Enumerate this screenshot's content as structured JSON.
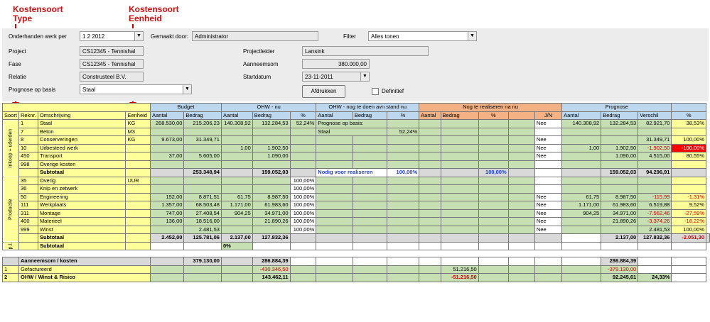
{
  "annotations": {
    "type_label": "Kostensoort\nType",
    "unit_label": "Kostensoort\nEenheid"
  },
  "form": {
    "onderhanden_label": "Onderhanden werk per",
    "onderhanden_value": "1 2 2012",
    "gemaakt_label": "Gemaakt door:",
    "gemaakt_value": "Administrator",
    "filter_label": "Filter",
    "filter_value": "Alles tonen",
    "project_label": "Project",
    "project_value": "CS12345 - Tennishal",
    "fase_label": "Fase",
    "fase_value": "CS12345 - Tennishal",
    "relatie_label": "Relatie",
    "relatie_value": "Construsteel B.V.",
    "prognose_label": "Prognose op basis",
    "prognose_value": "Staal",
    "projectleider_label": "Projectleider",
    "projectleider_value": "Lansink",
    "aanneemsom_label": "Aanneemsom",
    "aanneemsom_value": "380.000,00",
    "startdatum_label": "Startdatum",
    "startdatum_value": "23-11-2011",
    "print_button": "Afdrukken",
    "definitief_label": "Definitief"
  },
  "groups": {
    "budget": "Budget",
    "ohw_nu": "OHW - nu",
    "ohw_tedoen": "OHW - nog te doen avn stand nu",
    "nog_realiseren": "Nog te realiseren na nu",
    "prognose": "Prognose"
  },
  "columns": {
    "soort": "Soort",
    "reknr": "Reknr.",
    "omschrijving": "Omschrijving",
    "eenheid": "Eenheid",
    "aantal": "Aantal",
    "bedrag": "Bedrag",
    "pct": "%",
    "jn": "J/N",
    "verschil": "Verschil"
  },
  "section_labels": {
    "inkoop": "Inkoop + uderden",
    "productie": "Productie",
    "extra": "p.t."
  },
  "inkoop_rows": [
    {
      "reknr": "1",
      "oms": "Staal",
      "eh": "KG",
      "b_aantal": "268.530,00",
      "b_bedrag": "215.206,23",
      "o_aantal": "140.308,92",
      "o_bedrag": "132.284,53",
      "o_pct": "52,24%",
      "t_label": "Prognose op basis:",
      "jn": "Nee",
      "p_aantal": "140.308,92",
      "p_bedrag": "132.284,53",
      "p_verschil": "82.921,70",
      "p_pct": "38,53%"
    },
    {
      "reknr": "7",
      "oms": "Beton",
      "eh": "M3",
      "b_aantal": "",
      "b_bedrag": "",
      "o_aantal": "",
      "o_bedrag": "",
      "o_pct": "",
      "t_label": "Staal",
      "t_pct": "52,24%",
      "jn": "",
      "p_aantal": "",
      "p_bedrag": "",
      "p_verschil": "",
      "p_pct": ""
    },
    {
      "reknr": "8",
      "oms": "Conserveringen",
      "eh": "KG",
      "b_aantal": "9.673,00",
      "b_bedrag": "31.349,71",
      "o_aantal": "",
      "o_bedrag": "",
      "o_pct": "",
      "t_label": "",
      "jn": "Nee",
      "p_aantal": "",
      "p_bedrag": "",
      "p_verschil": "31.349,71",
      "p_pct": "100,00%"
    },
    {
      "reknr": "10",
      "oms": "Uitbesteed werk",
      "eh": "",
      "b_aantal": "",
      "b_bedrag": "",
      "o_aantal": "1,00",
      "o_bedrag": "1.902,50",
      "o_pct": "",
      "t_label": "",
      "jn": "Nee",
      "p_aantal": "1,00",
      "p_bedrag": "1.902,50",
      "p_verschil": "-1.902,50",
      "p_pct": "-100,00%"
    },
    {
      "reknr": "450",
      "oms": "Transport",
      "eh": "",
      "b_aantal": "37,00",
      "b_bedrag": "5.605,00",
      "o_aantal": "",
      "o_bedrag": "1.090,00",
      "o_pct": "",
      "t_label": "",
      "jn": "Nee",
      "p_aantal": "",
      "p_bedrag": "1.090,00",
      "p_verschil": "4.515,00",
      "p_pct": "80,55%"
    },
    {
      "reknr": "998",
      "oms": "Overige kosten",
      "eh": "",
      "b_aantal": "",
      "b_bedrag": "",
      "o_aantal": "",
      "o_bedrag": "",
      "o_pct": "",
      "t_label": "",
      "jn": "",
      "p_aantal": "",
      "p_bedrag": "",
      "p_verschil": "",
      "p_pct": ""
    }
  ],
  "inkoop_subtotal": {
    "label": "Subtotaal",
    "b_bedrag": "253.348,94",
    "o_bedrag": "159.052,03",
    "nodig": "Nodig voor realiseren",
    "nodig_pct": "100,00%",
    "n_pct": "100,00%",
    "p_bedrag": "159.052,03",
    "p_verschil": "94.296,91"
  },
  "productie_rows": [
    {
      "reknr": "35",
      "oms": "Overig",
      "eh": "UUR",
      "b_aantal": "",
      "b_bedrag": "",
      "o_aantal": "",
      "o_bedrag": "",
      "o_pct": "100,00%",
      "jn": "",
      "p_aantal": "",
      "p_bedrag": "",
      "p_verschil": "",
      "p_pct": ""
    },
    {
      "reknr": "36",
      "oms": "Knip en zetwerk",
      "eh": "",
      "b_aantal": "",
      "b_bedrag": "",
      "o_aantal": "",
      "o_bedrag": "",
      "o_pct": "100,00%",
      "jn": "",
      "p_aantal": "",
      "p_bedrag": "",
      "p_verschil": "",
      "p_pct": ""
    },
    {
      "reknr": "50",
      "oms": "Engineering",
      "eh": "",
      "b_aantal": "152,00",
      "b_bedrag": "8.871,51",
      "o_aantal": "61,75",
      "o_bedrag": "8.987,50",
      "o_pct": "100,00%",
      "jn": "Nee",
      "p_aantal": "61,75",
      "p_bedrag": "8.987,50",
      "p_verschil": "-115,99",
      "p_pct": "-1,31%"
    },
    {
      "reknr": "111",
      "oms": "Werkplaats",
      "eh": "",
      "b_aantal": "1.357,00",
      "b_bedrag": "68.503,48",
      "o_aantal": "1.171,00",
      "o_bedrag": "61.983,60",
      "o_pct": "100,00%",
      "jn": "Nee",
      "p_aantal": "1.171,00",
      "p_bedrag": "61.983,60",
      "p_verschil": "6.519,88",
      "p_pct": "9,52%"
    },
    {
      "reknr": "311",
      "oms": "Montage",
      "eh": "",
      "b_aantal": "747,00",
      "b_bedrag": "27.408,54",
      "o_aantal": "904,25",
      "o_bedrag": "34.971,00",
      "o_pct": "100,00%",
      "jn": "Nee",
      "p_aantal": "904,25",
      "p_bedrag": "34.971,00",
      "p_verschil": "-7.562,46",
      "p_pct": "-27,59%"
    },
    {
      "reknr": "400",
      "oms": "Materieel",
      "eh": "",
      "b_aantal": "136,00",
      "b_bedrag": "18.516,00",
      "o_aantal": "",
      "o_bedrag": "21.890,26",
      "o_pct": "100,00%",
      "jn": "Nee",
      "p_aantal": "",
      "p_bedrag": "21.890,26",
      "p_verschil": "-3.374,26",
      "p_pct": "-18,22%"
    },
    {
      "reknr": "999",
      "oms": "Winst",
      "eh": "",
      "b_aantal": "",
      "b_bedrag": "2.481,53",
      "o_aantal": "",
      "o_bedrag": "",
      "o_pct": "100,00%",
      "jn": "Nee",
      "p_aantal": "",
      "p_bedrag": "",
      "p_verschil": "2.481,53",
      "p_pct": "100,00%"
    }
  ],
  "productie_subtotal": {
    "label": "Subtotaal",
    "b_aantal": "2.452,00",
    "b_bedrag": "125.781,06",
    "o_aantal": "2.137,00",
    "o_bedrag": "127.832,36",
    "p_aantal": "2.137,00",
    "p_bedrag": "127.832,36",
    "p_verschil": "-2.051,30"
  },
  "extra_subtotal": {
    "label": "Subtotaal",
    "o_aantal": "0%"
  },
  "summary": {
    "aanneemsom_label": "Aanneemsom / kosten",
    "aanneemsom_b": "379.130,00",
    "aanneemsom_o": "286.884,39",
    "aanneemsom_p": "286.884,39",
    "gef_num": "1",
    "gef_label": "Gefactureerd",
    "gef_o": "-430.346,50",
    "gef_t": "51.216,50",
    "gef_p": "-379.130,00",
    "ohw_num": "2",
    "ohw_label": "OHW / Winst & Risico",
    "ohw_o": "143.462,11",
    "ohw_t": "-51.216,50",
    "ohw_p": "92.245,61",
    "ohw_pct": "24,33%"
  }
}
